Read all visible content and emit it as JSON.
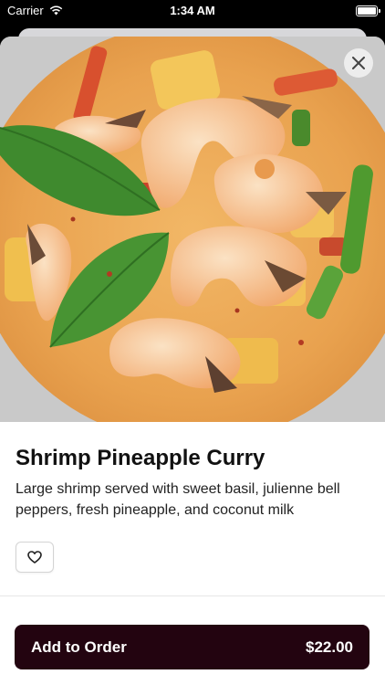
{
  "status_bar": {
    "carrier": "Carrier",
    "time": "1:34 AM"
  },
  "item": {
    "title": "Shrimp Pineapple Curry",
    "description": "Large shrimp served with sweet basil, julienne bell peppers, fresh pineapple, and coconut milk"
  },
  "actions": {
    "add_label": "Add to Order",
    "price": "$22.00"
  },
  "icons": {
    "close": "close-icon",
    "favorite": "heart-icon",
    "wifi": "wifi-icon",
    "battery": "battery-icon"
  },
  "colors": {
    "primary_button": "#230410",
    "background": "#ffffff"
  }
}
